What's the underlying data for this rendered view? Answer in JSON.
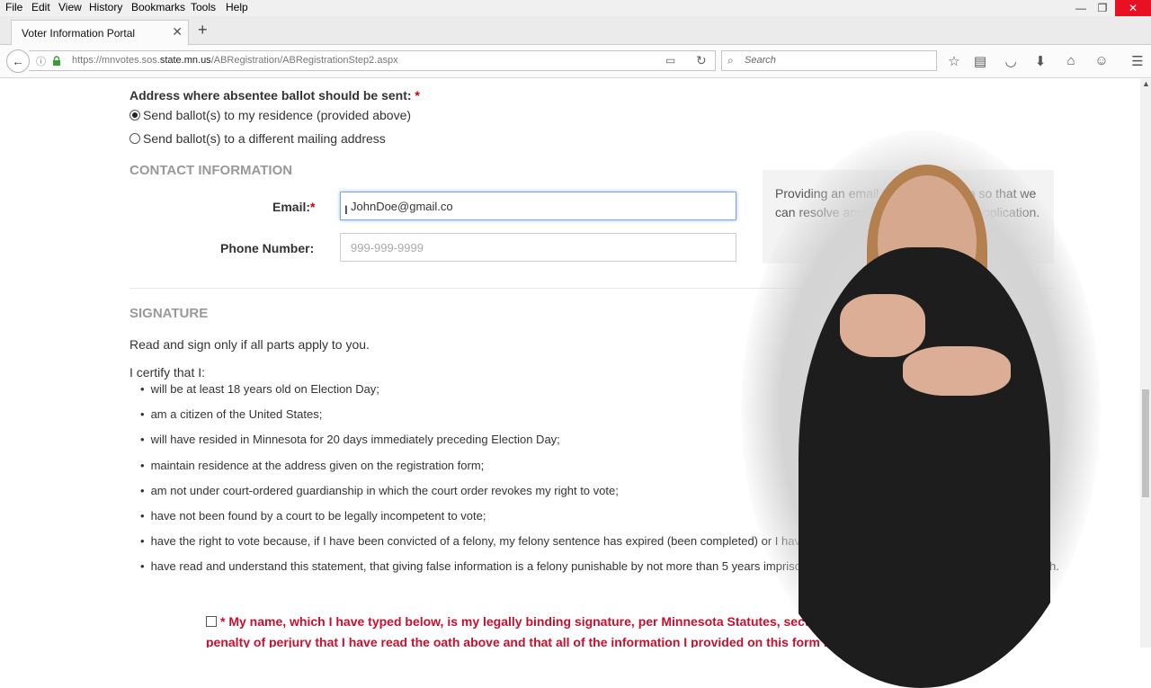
{
  "menu": {
    "items": [
      {
        "label": "File"
      },
      {
        "label": "Edit"
      },
      {
        "label": "View"
      },
      {
        "label": "History"
      },
      {
        "label": "Bookmarks"
      },
      {
        "label": "Tools"
      },
      {
        "label": "Help"
      }
    ]
  },
  "window_controls": {
    "minimize": "—",
    "restore": "❐",
    "close": "✕"
  },
  "tab": {
    "title": "Voter Information Portal",
    "close": "✕",
    "new": "+"
  },
  "address": {
    "url_prefix": "https://mnvotes.sos.",
    "url_domain": "state.mn.us",
    "url_path": "/ABRegistration/ABRegistrationStep2.aspx"
  },
  "search": {
    "placeholder": "Search"
  },
  "form": {
    "ballot_label": "Address where absentee ballot should be sent:",
    "required_mark": "*",
    "option_residence": "Send ballot(s) to my residence (provided above)",
    "option_mailing": "Send ballot(s) to a different mailing address",
    "contact_heading": "CONTACT INFORMATION",
    "email_label": "Email:",
    "email_value": "JohnDoe@gmail.co",
    "phone_label": "Phone Number:",
    "phone_placeholder": "999-999-9999",
    "help_text": "Providing an email address will help so that we can resolve any problems with your application.",
    "signature_heading": "SIGNATURE",
    "sign_instruction": "Read and sign only if all parts apply to you.",
    "certify": "I certify that I:",
    "bullets": [
      "will be at least 18 years old on Election Day;",
      "am a citizen of the United States;",
      "will have resided in Minnesota for 20 days immediately preceding Election Day;",
      "maintain residence at the address given on the registration form;",
      "am not under court-ordered guardianship in which the court order revokes my right to vote;",
      "have not been found by a court to be legally incompetent to vote;",
      "have the right to vote because, if I have been convicted of a felony, my felony sentence has expired (been completed) or I have been discharged from my sentence;",
      "have read and understand this statement, that giving false information is a felony punishable by not more than 5 years imprisonment or a fine of not more than $10,000, or both."
    ],
    "oath_line1": "* My name, which I have typed below, is my legally binding signature, per Minnesota Statutes, section 358.116, I certify under",
    "oath_line2": "penalty of perjury that I have read the oath above and that all of the information I provided on this form is true and correct."
  }
}
